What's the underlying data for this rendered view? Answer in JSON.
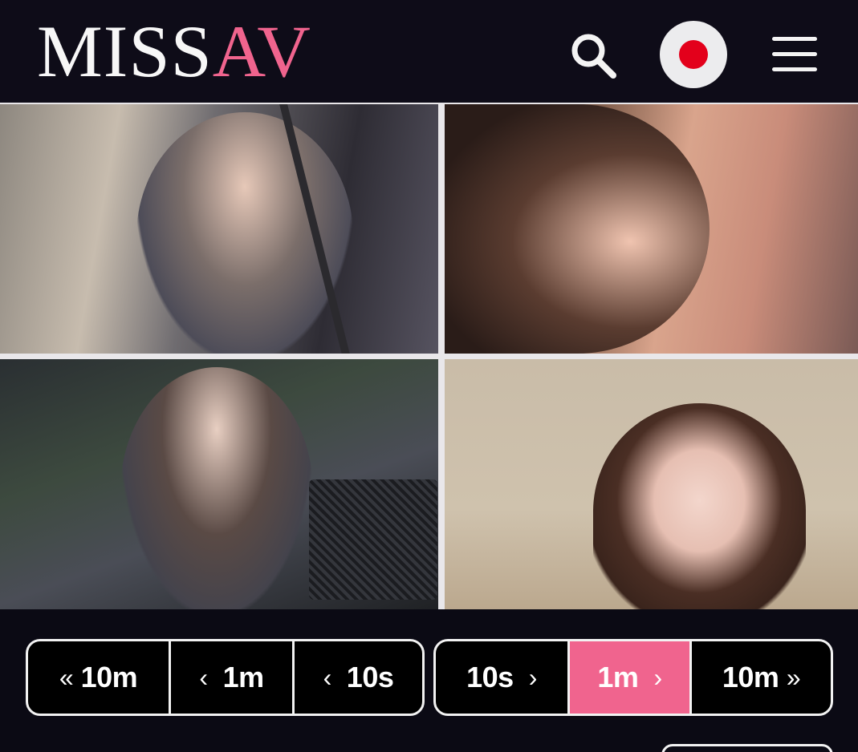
{
  "header": {
    "logo_part1": "MISS",
    "logo_part2": "AV",
    "brand_color": "#f0648e",
    "icons": [
      "search-icon",
      "japanese-flag-icon",
      "hamburger-menu-icon"
    ]
  },
  "thumbnails": {
    "count": 4
  },
  "seek_controls": {
    "back": [
      {
        "label": "10m",
        "arrow": "«"
      },
      {
        "label": "1m",
        "arrow": "‹"
      },
      {
        "label": "10s",
        "arrow": "‹"
      }
    ],
    "forward": [
      {
        "label": "10s",
        "arrow": "›"
      },
      {
        "label": "1m",
        "arrow": "›",
        "active": true
      },
      {
        "label": "10m",
        "arrow": "»"
      }
    ],
    "active_color": "#f0648e"
  }
}
